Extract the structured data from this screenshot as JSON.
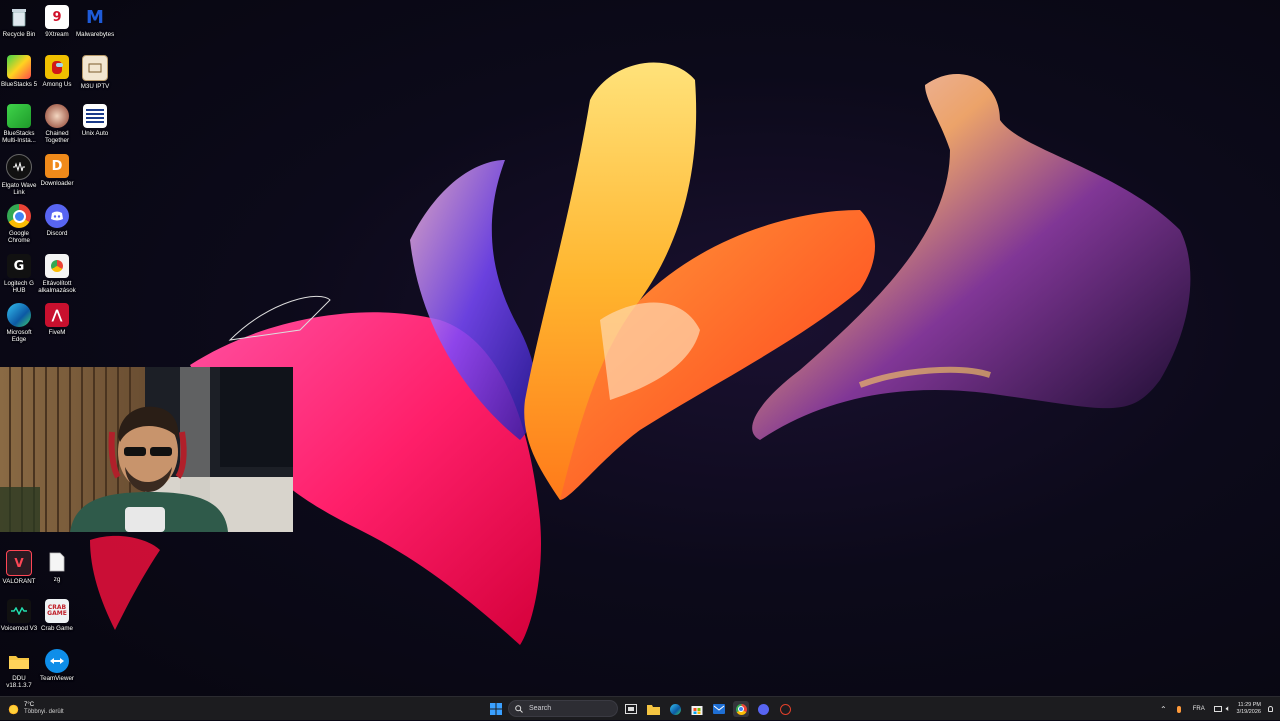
{
  "desktop_icons": [
    {
      "label": "Recycle Bin",
      "icon": "recycle-bin-icon"
    },
    {
      "label": "9Xtream",
      "icon": "9xtream-icon"
    },
    {
      "label": "Malwarebytes",
      "icon": "malwarebytes-icon"
    },
    {
      "label": "BlueStacks 5",
      "icon": "bluestacks-icon"
    },
    {
      "label": "Among Us",
      "icon": "among-us-icon"
    },
    {
      "label": "M3U IPTV",
      "icon": "m3u-iptv-icon"
    },
    {
      "label": "BlueStacks Multi-Insta...",
      "icon": "bluestacks-multi-icon"
    },
    {
      "label": "Chained Together",
      "icon": "chained-together-icon"
    },
    {
      "label": "Unix Auto",
      "icon": "unix-auto-icon"
    },
    {
      "label": "Elgato Wave Link",
      "icon": "elgato-wave-icon"
    },
    {
      "label": "Downloader",
      "icon": "downloader-icon"
    },
    {
      "label": "Google Chrome",
      "icon": "chrome-icon"
    },
    {
      "label": "Discord",
      "icon": "discord-icon"
    },
    {
      "label": "Logitech G HUB",
      "icon": "logitech-ghub-icon"
    },
    {
      "label": "Eltávolított alkalmazások",
      "icon": "removed-apps-icon"
    },
    {
      "label": "Microsoft Edge",
      "icon": "edge-icon"
    },
    {
      "label": "FiveM",
      "icon": "fivem-icon"
    },
    {
      "label": "VALORANT",
      "icon": "valorant-icon"
    },
    {
      "label": "zg",
      "icon": "text-file-icon"
    },
    {
      "label": "Voicemod V3",
      "icon": "voicemod-icon"
    },
    {
      "label": "Crab Game",
      "icon": "crab-game-icon"
    },
    {
      "label": "DDU v18.1.3.7",
      "icon": "folder-icon"
    },
    {
      "label": "TeamViewer",
      "icon": "teamviewer-icon"
    }
  ],
  "taskbar": {
    "weather_temp": "7°C",
    "weather_desc": "Többnyi. derült",
    "search_placeholder": "Search",
    "apps": [
      "start-icon",
      "search-icon",
      "task-view-icon",
      "file-explorer-icon",
      "edge-icon",
      "store-icon",
      "mail-icon",
      "chrome-icon",
      "discord-icon",
      "app-icon"
    ],
    "language": "FRA",
    "time": "11:29 PM",
    "date": "3/19/2026"
  },
  "colors": {
    "taskbar_bg": "#1c1c1f",
    "accent": "#0078d4"
  }
}
